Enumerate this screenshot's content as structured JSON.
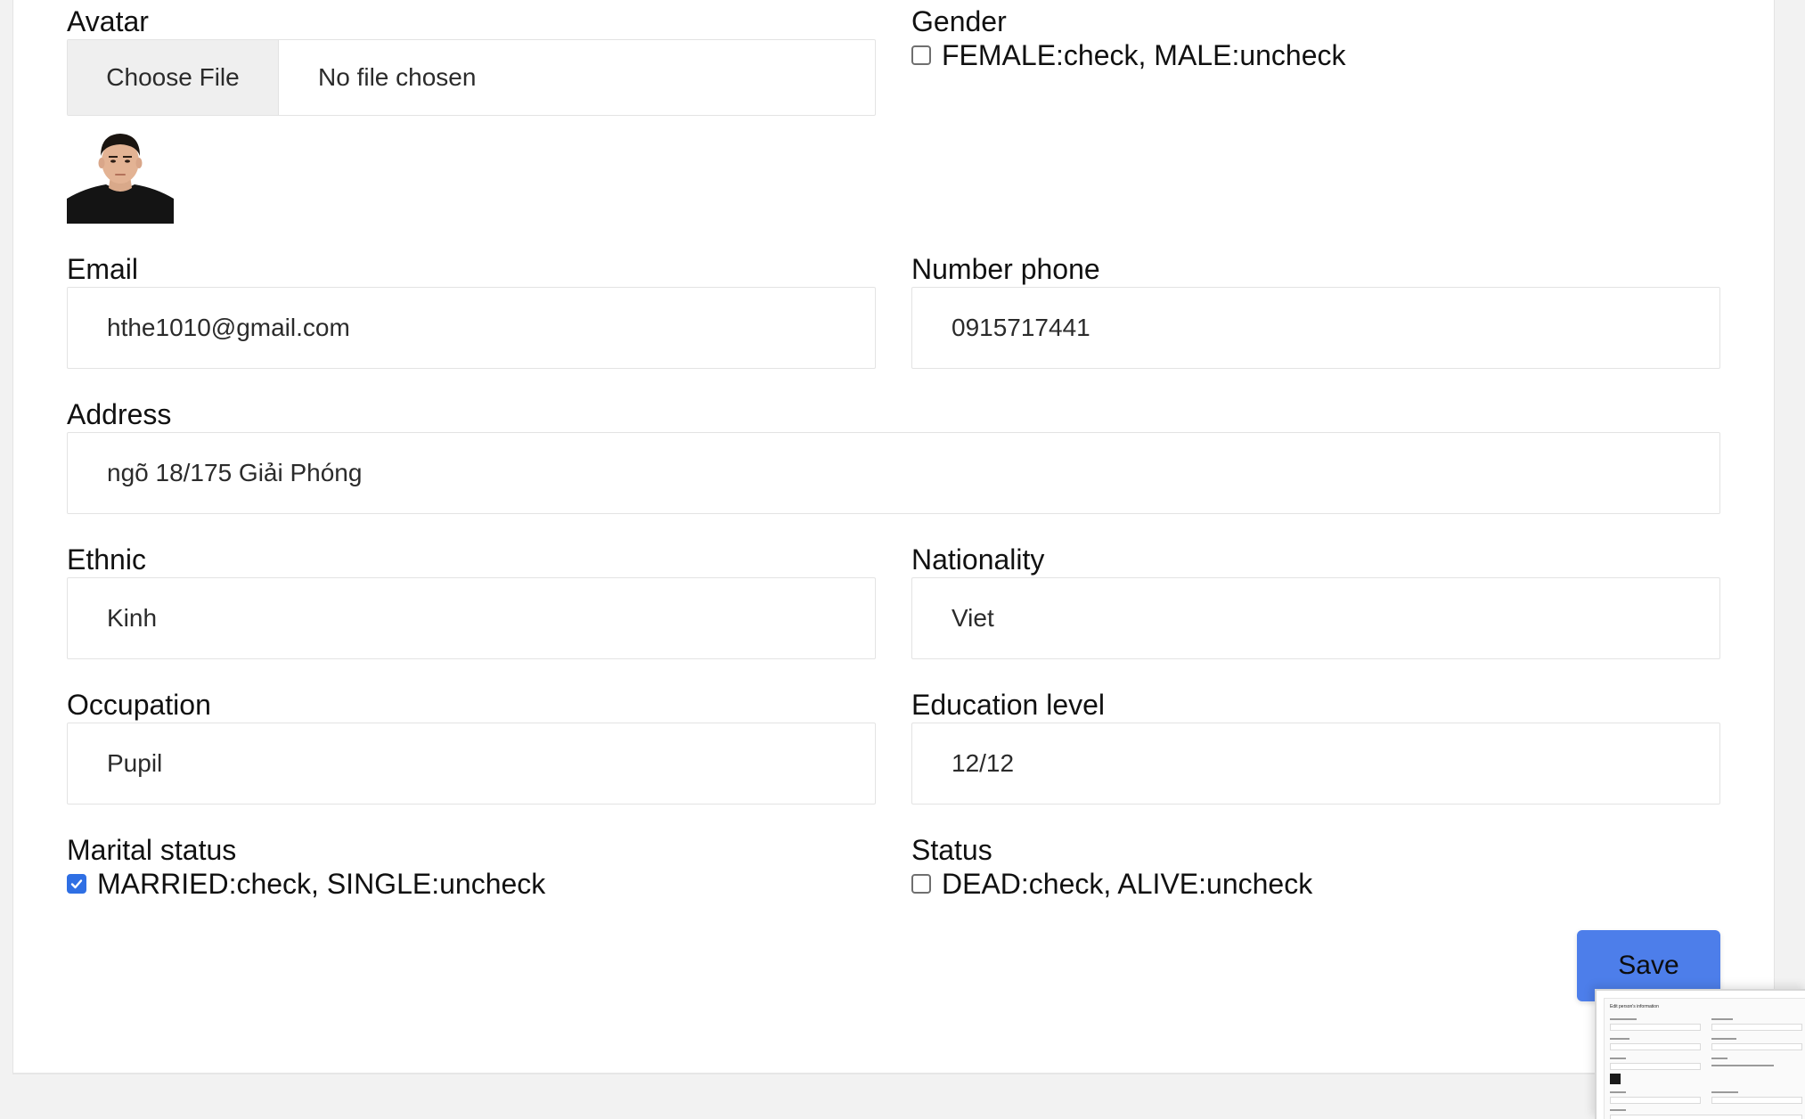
{
  "form": {
    "avatar": {
      "label": "Avatar",
      "choose_file_label": "Choose File",
      "file_status": "No file chosen"
    },
    "gender": {
      "label": "Gender",
      "checkbox_text": "FEMALE:check, MALE:uncheck",
      "checked": false
    },
    "email": {
      "label": "Email",
      "value": "hthe1010@gmail.com"
    },
    "number_phone": {
      "label": "Number phone",
      "value": "0915717441"
    },
    "address": {
      "label": "Address",
      "value": "ngõ 18/175 Giải Phóng"
    },
    "ethnic": {
      "label": "Ethnic",
      "value": "Kinh"
    },
    "nationality": {
      "label": "Nationality",
      "value": "Viet"
    },
    "occupation": {
      "label": "Occupation",
      "value": "Pupil"
    },
    "education_level": {
      "label": "Education level",
      "value": "12/12"
    },
    "marital_status": {
      "label": "Marital status",
      "checkbox_text": "MARRIED:check, SINGLE:uncheck",
      "checked": true
    },
    "status": {
      "label": "Status",
      "checkbox_text": "DEAD:check, ALIVE:uncheck",
      "checked": false
    },
    "save_label": "Save"
  },
  "thumbnail": {
    "title": "Edit person's information"
  },
  "colors": {
    "accent": "#4d7eea",
    "checkbox_checked": "#2f6fe4",
    "page_background": "#f2f2f2",
    "card_background": "#ffffff"
  },
  "icons": {
    "check": "check-icon"
  }
}
